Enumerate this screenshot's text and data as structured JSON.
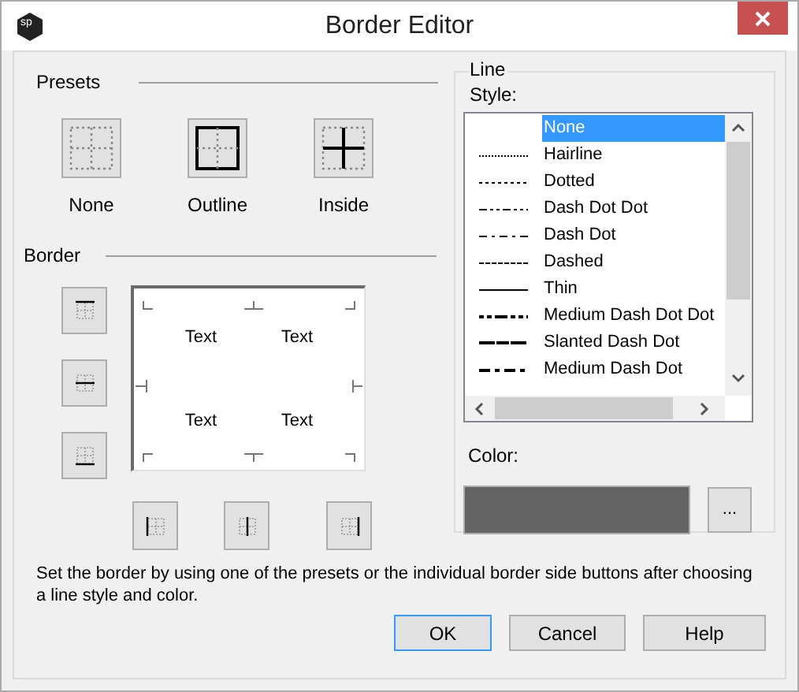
{
  "window": {
    "title": "Border Editor",
    "app_icon": "sp"
  },
  "presets": {
    "label": "Presets",
    "items": [
      {
        "kind": "none",
        "label": "None"
      },
      {
        "kind": "outline",
        "label": "Outline"
      },
      {
        "kind": "inside",
        "label": "Inside"
      }
    ]
  },
  "border": {
    "label": "Border",
    "side_buttons": [
      {
        "kind": "top"
      },
      {
        "kind": "middle_h"
      },
      {
        "kind": "bottom"
      }
    ],
    "bottom_buttons": [
      {
        "kind": "left"
      },
      {
        "kind": "middle_v"
      },
      {
        "kind": "right"
      }
    ],
    "preview_texts": [
      "Text",
      "Text",
      "Text",
      "Text"
    ]
  },
  "line": {
    "label": "Line",
    "style_label": "Style:",
    "styles": [
      {
        "kind": "none",
        "label": "None",
        "selected": true
      },
      {
        "kind": "hairline",
        "label": "Hairline",
        "selected": false
      },
      {
        "kind": "dotted",
        "label": "Dotted",
        "selected": false
      },
      {
        "kind": "dash_dot_dot",
        "label": "Dash Dot Dot",
        "selected": false
      },
      {
        "kind": "dash_dot",
        "label": "Dash Dot",
        "selected": false
      },
      {
        "kind": "dashed",
        "label": "Dashed",
        "selected": false
      },
      {
        "kind": "thin",
        "label": "Thin",
        "selected": false
      },
      {
        "kind": "medium_dash_dot_dot",
        "label": "Medium Dash Dot Dot",
        "selected": false
      },
      {
        "kind": "slanted_dash_dot",
        "label": "Slanted Dash Dot",
        "selected": false
      },
      {
        "kind": "medium_dash_dot",
        "label": "Medium Dash Dot",
        "selected": false
      }
    ],
    "color_label": "Color:",
    "color": "#646464",
    "color_button": "..."
  },
  "instructions": "Set the border by using one of the presets or the individual border side buttons after choosing a line style and color.",
  "buttons": [
    "OK",
    "Cancel",
    "Help"
  ]
}
